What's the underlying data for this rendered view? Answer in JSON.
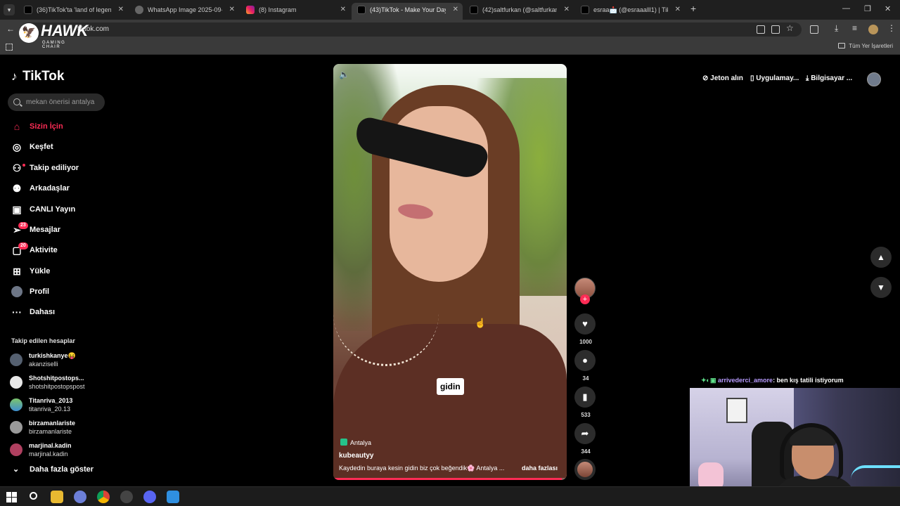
{
  "browser": {
    "tabs": [
      {
        "title": "(36)TikTok'ta 'land of legends c",
        "favicon": "tiktok-icon",
        "active": false
      },
      {
        "title": "WhatsApp Image 2025-09-02 a",
        "favicon": "globe-icon",
        "active": false
      },
      {
        "title": "(8) Instagram",
        "favicon": "instagram-icon",
        "active": false
      },
      {
        "title": "(43)TikTok - Make Your Day",
        "favicon": "tiktok-icon",
        "active": true
      },
      {
        "title": "(42)saltfurkan (@saltfurkan) | Ti",
        "favicon": "tiktok-icon",
        "active": false
      },
      {
        "title": "esraa📩 (@esraaalll1) | TikTok",
        "favicon": "tiktok-icon",
        "active": false
      }
    ],
    "url": "tiktok.com",
    "bookmarks_all": "Tüm Yer İşaretleri"
  },
  "overlay_logo": {
    "name": "HAWK",
    "sub": "GAMING CHAIR"
  },
  "sidebar": {
    "logo": "TikTok",
    "search_placeholder": "mekan önerisi antalya",
    "nav": [
      {
        "label": "Sizin İçin",
        "icon": "home-icon",
        "active": true
      },
      {
        "label": "Keşfet",
        "icon": "compass-icon"
      },
      {
        "label": "Takip ediliyor",
        "icon": "following-icon"
      },
      {
        "label": "Arkadaşlar",
        "icon": "friends-icon"
      },
      {
        "label": "CANLI Yayın",
        "icon": "live-icon"
      },
      {
        "label": "Mesajlar",
        "icon": "message-icon",
        "badge": "23"
      },
      {
        "label": "Aktivite",
        "icon": "activity-icon",
        "badge": "20"
      },
      {
        "label": "Yükle",
        "icon": "upload-icon"
      },
      {
        "label": "Profil",
        "icon": "profile-avatar-icon"
      },
      {
        "label": "Dahası",
        "icon": "more-icon"
      }
    ],
    "following_title": "Takip edilen hesaplar",
    "following": [
      {
        "name": "turkishkanye😝",
        "handle": "akanziselli"
      },
      {
        "name": "Shotshitpostops...",
        "handle": "shotshitpostopspost"
      },
      {
        "name": "Titanriva_2013",
        "handle": "titanriva_20.13"
      },
      {
        "name": "birzamanlariste",
        "handle": "birzamanlariste"
      },
      {
        "name": "marjinal.kadin",
        "handle": "marjinal.kadin"
      }
    ],
    "show_more": "Daha fazla göster"
  },
  "video": {
    "caption_overlay": "gidin",
    "location": "Antalya",
    "username": "kubeautyy",
    "description": "Kaydedin buraya kesin gidin biz çok beğendik🌸  Antalya ...",
    "more_label": "daha fazlası",
    "progress": 0.98,
    "likes": "1000",
    "comments": "34",
    "saves": "533",
    "shares": "344"
  },
  "header_actions": {
    "coins": "Jeton alın",
    "app": "Uygulamay...",
    "desktop": "Bilgisayar ..."
  },
  "stream": {
    "chat_user": "arrivederci_amore",
    "chat_message": ": ben kış tatili istiyorum"
  },
  "colors": {
    "accent": "#fe2c55",
    "background": "#000000"
  }
}
